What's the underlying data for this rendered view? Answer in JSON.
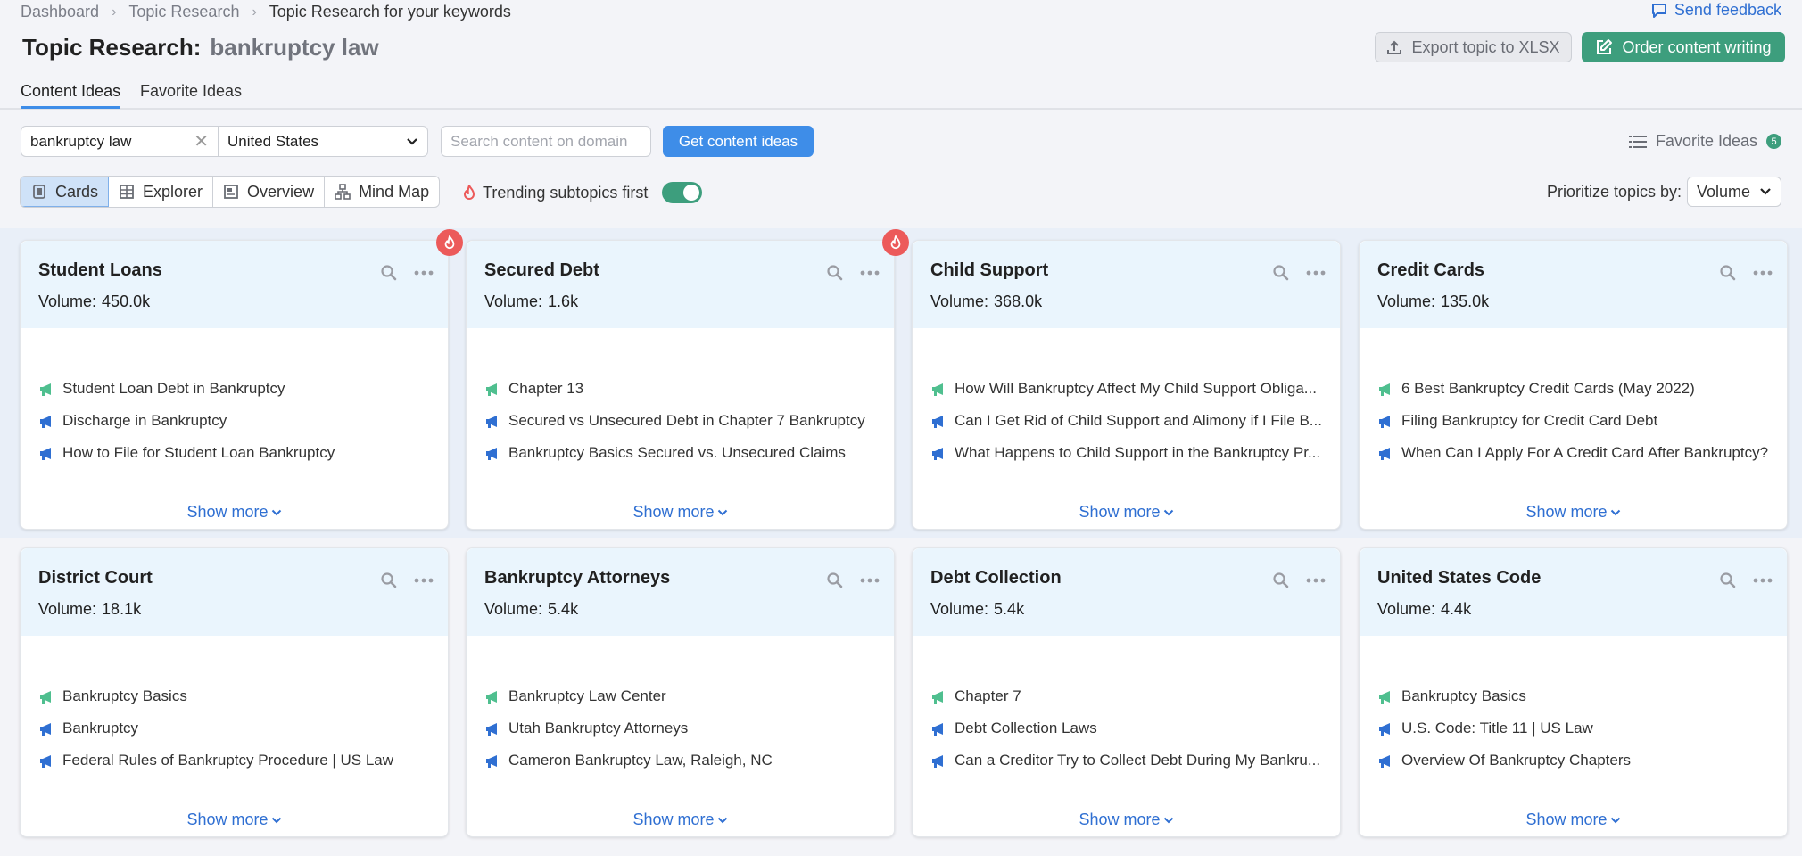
{
  "breadcrumb": [
    "Dashboard",
    "Topic Research",
    "Topic Research for your keywords"
  ],
  "send_feedback": "Send feedback",
  "title": {
    "prefix": "Topic Research:",
    "keyword": "bankruptcy law"
  },
  "buttons": {
    "export": "Export topic to XLSX",
    "order": "Order content writing",
    "get_ideas": "Get content ideas"
  },
  "tabs": [
    "Content Ideas",
    "Favorite Ideas"
  ],
  "search": {
    "keyword_value": "bankruptcy law",
    "database": "United States",
    "domain_placeholder": "Search content on domain"
  },
  "favorite_ideas": {
    "label": "Favorite Ideas",
    "count": "5"
  },
  "views": [
    "Cards",
    "Explorer",
    "Overview",
    "Mind Map"
  ],
  "active_view": "Cards",
  "trending": {
    "label": "Trending subtopics first",
    "enabled": true
  },
  "prioritize": {
    "label": "Prioritize topics by:",
    "value": "Volume"
  },
  "colors": {
    "accent_blue": "#3e8de8",
    "brand_green": "#3d9e7d",
    "trending_red": "#ec5a5a",
    "idea_green": "#4fbf8f",
    "idea_blue": "#2f6fd2"
  },
  "volume_label": "Volume:",
  "show_more": "Show more",
  "cards": [
    {
      "title": "Student Loans",
      "volume": "450.0k",
      "trending": true,
      "ideas": [
        "Student Loan Debt in Bankruptcy",
        "Discharge in Bankruptcy",
        "How to File for Student Loan Bankruptcy"
      ]
    },
    {
      "title": "Secured Debt",
      "volume": "1.6k",
      "trending": true,
      "ideas": [
        "Chapter 13",
        "Secured vs Unsecured Debt in Chapter 7 Bankruptcy",
        "Bankruptcy Basics Secured vs. Unsecured Claims"
      ]
    },
    {
      "title": "Child Support",
      "volume": "368.0k",
      "trending": false,
      "ideas": [
        "How Will Bankruptcy Affect My Child Support Obliga...",
        "Can I Get Rid of Child Support and Alimony if I File B...",
        "What Happens to Child Support in the Bankruptcy Pr..."
      ]
    },
    {
      "title": "Credit Cards",
      "volume": "135.0k",
      "trending": false,
      "ideas": [
        "6 Best Bankruptcy Credit Cards (May 2022)",
        "Filing Bankruptcy for Credit Card Debt",
        "When Can I Apply For A Credit Card After Bankruptcy?"
      ]
    },
    {
      "title": "District Court",
      "volume": "18.1k",
      "trending": false,
      "ideas": [
        "Bankruptcy Basics",
        "Bankruptcy",
        "Federal Rules of Bankruptcy Procedure | US Law"
      ]
    },
    {
      "title": "Bankruptcy Attorneys",
      "volume": "5.4k",
      "trending": false,
      "ideas": [
        "Bankruptcy Law Center",
        "Utah Bankruptcy Attorneys",
        "Cameron Bankruptcy Law, Raleigh, NC"
      ]
    },
    {
      "title": "Debt Collection",
      "volume": "5.4k",
      "trending": false,
      "ideas": [
        "Chapter 7",
        "Debt Collection Laws",
        "Can a Creditor Try to Collect Debt During My Bankru..."
      ]
    },
    {
      "title": "United States Code",
      "volume": "4.4k",
      "trending": false,
      "ideas": [
        "Bankruptcy Basics",
        "U.S. Code: Title 11 | US Law",
        "Overview Of Bankruptcy Chapters"
      ]
    }
  ]
}
